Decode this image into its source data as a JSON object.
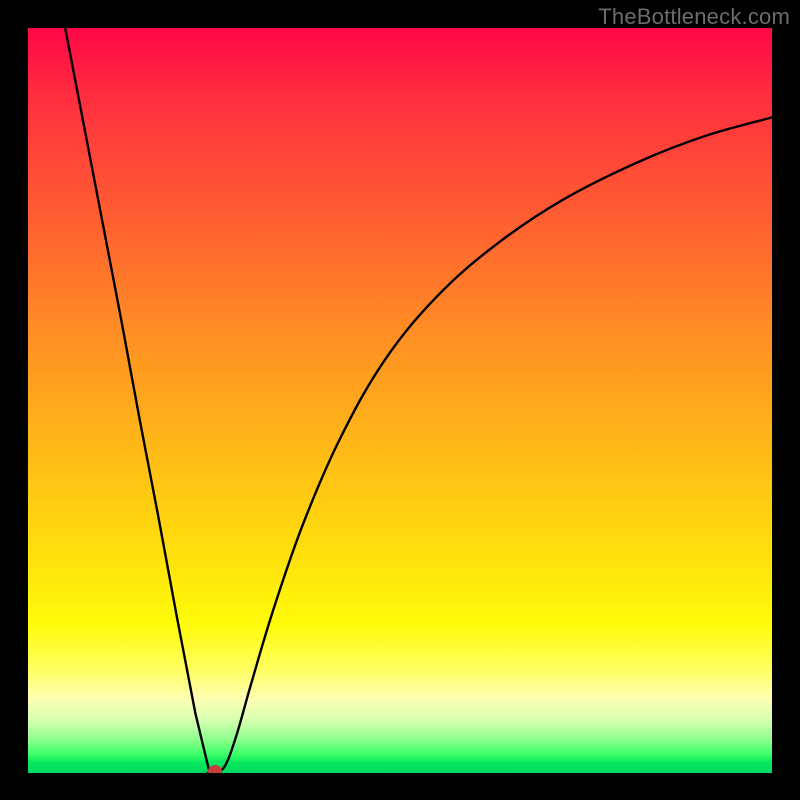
{
  "attribution": "TheBottleneck.com",
  "colors": {
    "frame": "#000000",
    "attribution_text": "#6c6c6c",
    "curve": "#000000",
    "dot": "#c63f3f",
    "gradient_stops": [
      "#ff0746",
      "#ff2d3f",
      "#ff5d32",
      "#ff8b25",
      "#ffb518",
      "#ffde0d",
      "#fffb09",
      "#ffff60",
      "#ffffb2",
      "#d3ffb0",
      "#8dff8c",
      "#41ff6a",
      "#08e85e",
      "#00d85f"
    ]
  },
  "chart_data": {
    "type": "line",
    "title": "",
    "xlabel": "",
    "ylabel": "",
    "xlim": [
      0,
      100
    ],
    "ylim": [
      0,
      100
    ],
    "series": [
      {
        "name": "left-branch",
        "x": [
          5,
          7.5,
          10,
          12.5,
          15,
          17.5,
          20,
          22.5,
          24.3,
          25.2
        ],
        "values": [
          100,
          87,
          74,
          61,
          47.5,
          34.5,
          21,
          8,
          0.5,
          0
        ]
      },
      {
        "name": "right-branch",
        "x": [
          25.2,
          26.5,
          28,
          30,
          33,
          37,
          42,
          48,
          55,
          63,
          72,
          82,
          91,
          100
        ],
        "values": [
          0,
          1,
          5,
          12,
          22,
          33.5,
          45,
          55.5,
          64,
          71,
          77,
          82,
          85.5,
          88
        ]
      }
    ],
    "marker": {
      "name": "minimum-dot",
      "x": 25.2,
      "y": 0
    },
    "notes": "Background is a vertical heat gradient (red top → green bottom). Curve is a V/checkmark shape with minimum at ~x=25. No axis ticks or labels are shown; values are read as percentage of plot extent."
  }
}
